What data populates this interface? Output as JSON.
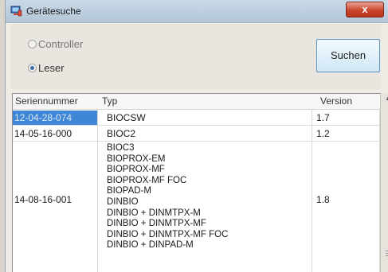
{
  "window": {
    "title": "Gerätesuche",
    "close_label": "x"
  },
  "options": [
    {
      "label": "Controller",
      "selected": false
    },
    {
      "label": "Leser",
      "selected": true
    }
  ],
  "search_button": "Suchen",
  "table": {
    "headers": {
      "serial": "Seriennummer",
      "type": "Typ",
      "version": "Version"
    },
    "rows": [
      {
        "serial": "12-04-28-074",
        "types": [
          "BIOCSW"
        ],
        "version": "1.7",
        "selected": true
      },
      {
        "serial": "14-05-16-000",
        "types": [
          "BIOC2"
        ],
        "version": "1.2",
        "selected": false
      },
      {
        "serial": "14-08-16-001",
        "types": [
          "BIOC3",
          "BIOPROX-EM",
          "BIOPROX-MF",
          "BIOPROX-MF FOC",
          "BIOPAD-M",
          "DINBIO",
          "DINBIO + DINMTPX-M",
          "DINBIO + DINMTPX-MF",
          "DINBIO + DINMTPX-MF FOC",
          "DINBIO + DINPAD-M"
        ],
        "version": "1.8",
        "selected": false
      }
    ]
  },
  "icons": {
    "app": "computer-icon",
    "close": "close-icon",
    "scroll_up": "arrow-up-icon"
  },
  "colors": {
    "selection": "#3f86d6",
    "close_button": "#c9462d",
    "button_border": "#5e95c2"
  }
}
